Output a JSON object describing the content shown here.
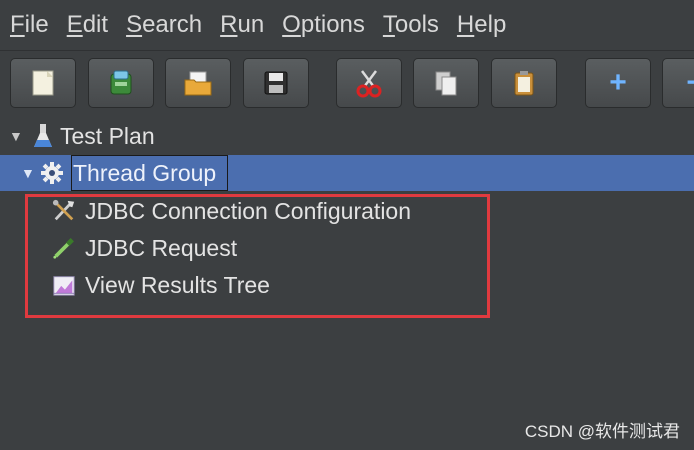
{
  "menu": {
    "items": [
      {
        "mnemonic": "F",
        "rest": "ile"
      },
      {
        "mnemonic": "E",
        "rest": "dit"
      },
      {
        "mnemonic": "S",
        "rest": "earch"
      },
      {
        "mnemonic": "R",
        "rest": "un"
      },
      {
        "mnemonic": "O",
        "rest": "ptions"
      },
      {
        "mnemonic": "T",
        "rest": "ools"
      },
      {
        "mnemonic": "H",
        "rest": "elp"
      }
    ]
  },
  "toolbar": {
    "buttons": [
      "new-icon",
      "templates-icon",
      "open-icon",
      "save-icon",
      "cut-icon",
      "copy-icon",
      "paste-icon",
      "expand-icon",
      "collapse-icon"
    ],
    "expand_label": "+",
    "collapse_label": "−"
  },
  "tree": {
    "test_plan": "Test Plan",
    "thread_group": "Thread Group",
    "children": [
      {
        "label": "JDBC Connection Configuration",
        "icon": "config-tools-icon"
      },
      {
        "label": "JDBC Request",
        "icon": "sampler-pipette-icon"
      },
      {
        "label": "View Results Tree",
        "icon": "listener-graph-icon"
      }
    ]
  },
  "colors": {
    "background": "#3c3f41",
    "selection": "#4b6eaf",
    "highlight_border": "#e03a3f"
  },
  "watermark": "CSDN @软件测试君"
}
